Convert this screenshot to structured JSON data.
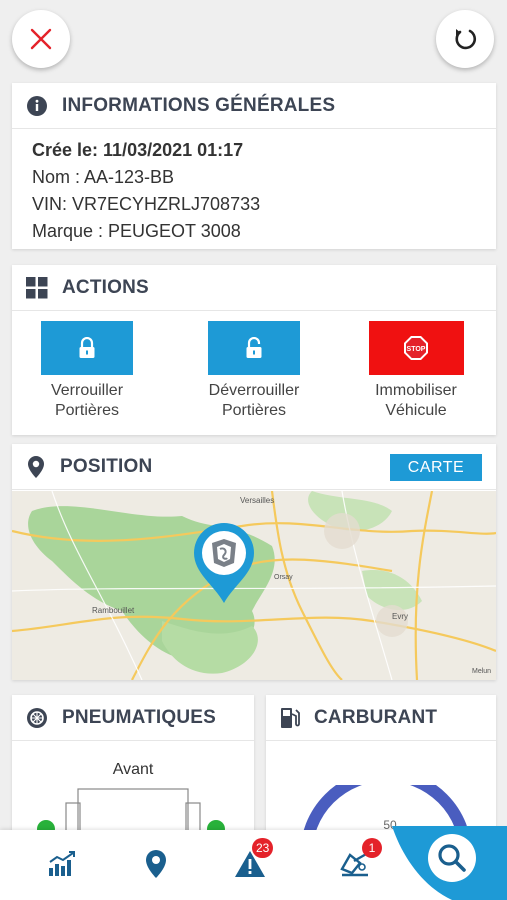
{
  "info": {
    "title": "INFORMATIONS GÉNÉRALES",
    "created": "Crée le: 11/03/2021 01:17",
    "name": "Nom : AA-123-BB",
    "vin": "VIN: VR7ECYHZRLJ708733",
    "brand": "Marque : PEUGEOT 3008"
  },
  "actions": {
    "title": "ACTIONS",
    "lock_line1": "Verrouiller",
    "lock_line2": "Portières",
    "unlock_line1": "Déverrouiller",
    "unlock_line2": "Portières",
    "immob_line1": "Immobiliser",
    "immob_line2": "Véhicule",
    "stop_text": "STOP"
  },
  "position": {
    "title": "POSITION",
    "carte_label": "CARTE",
    "map_labels": {
      "versailles": "Versailles",
      "orsay": "Orsay",
      "rambouillet": "Rambouillet",
      "evry": "Evry",
      "melun": "Melun"
    }
  },
  "tires": {
    "title": "PNEUMATIQUES",
    "front_label": "Avant"
  },
  "fuel": {
    "title": "CARBURANT",
    "gauge_label": "50"
  },
  "nav": {
    "alerts_count": "23",
    "notifications_count": "1"
  },
  "colors": {
    "accent": "#1e9ad6",
    "danger": "#e4222a",
    "title": "#3d4554",
    "nav_blue": "#1a5f8e"
  }
}
